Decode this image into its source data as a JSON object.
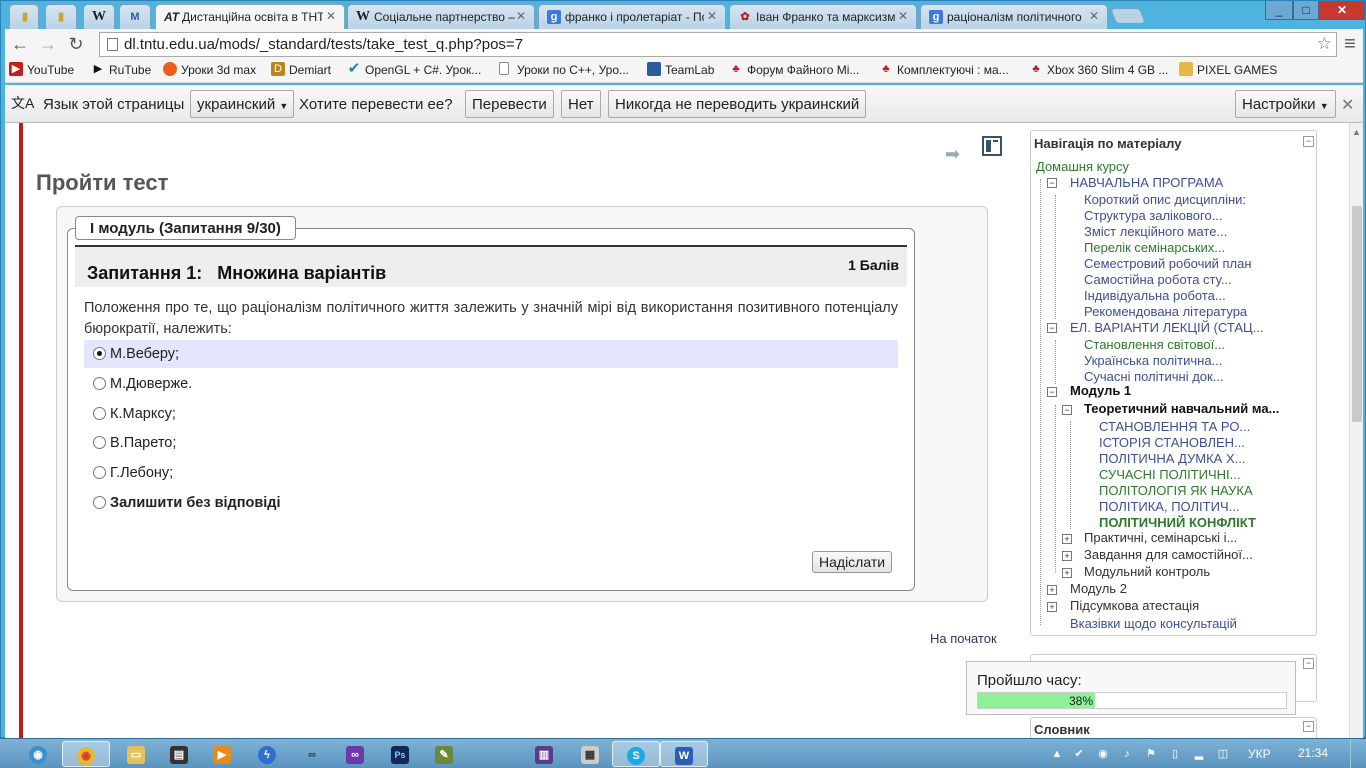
{
  "browser": {
    "tabs": [
      {
        "label": "",
        "icon": "note-icon",
        "pinned": true
      },
      {
        "label": "",
        "icon": "note-icon",
        "pinned": true
      },
      {
        "label": "W",
        "icon": "wikipedia-icon",
        "pinned": true
      },
      {
        "label": "",
        "icon": "moodle-icon",
        "pinned": true
      },
      {
        "label": "Дистанційна освіта в ТНТ",
        "icon": "at-icon",
        "active": true
      },
      {
        "label": "Соціальне партнерство –",
        "icon": "wikipedia-icon"
      },
      {
        "label": "франко і пролетаріат - По",
        "icon": "google-icon"
      },
      {
        "label": "Іван Франко та марксизм",
        "icon": "flower-icon"
      },
      {
        "label": "раціоналізм політичного",
        "icon": "google-icon"
      }
    ],
    "url": "dl.tntu.edu.ua/mods/_standard/tests/take_test_q.php?pos=7",
    "window_buttons": {
      "min": "_",
      "max": "□",
      "close": "✕"
    }
  },
  "bookmarks": [
    {
      "label": "YouTube",
      "icon": "youtube-icon",
      "color": "#cc1b1b"
    },
    {
      "label": "RuTube",
      "icon": "rutube-icon",
      "color": "#111111"
    },
    {
      "label": "Уроки 3d max",
      "icon": "3dmax-icon",
      "color": "#e8601a"
    },
    {
      "label": "Demiart",
      "icon": "demiart-icon",
      "color": "#b8861b"
    },
    {
      "label": "OpenGL + C#. Урок...",
      "icon": "check-icon",
      "color": "#1e7fd0"
    },
    {
      "label": "Уроки по C++, Уро...",
      "icon": "page-icon",
      "color": "#888888"
    },
    {
      "label": "TeamLab",
      "icon": "teamlab-icon",
      "color": "#2a5d9a"
    },
    {
      "label": "Форум Файного Мі...",
      "icon": "forum-icon",
      "color": "#b41d1d"
    },
    {
      "label": "Комплектуючі : ма...",
      "icon": "forum-icon",
      "color": "#b41d1d"
    },
    {
      "label": "Xbox 360 Slim 4 GB ...",
      "icon": "forum-icon",
      "color": "#b41d1d"
    },
    {
      "label": "PIXEL GAMES",
      "icon": "folder-icon",
      "color": "#e6b84a"
    }
  ],
  "translate_bar": {
    "lang_label": "Язык этой страницы",
    "lang_value": "украинский",
    "question": "Хотите перевести ее?",
    "translate_btn": "Перевести",
    "no_btn": "Нет",
    "never_btn": "Никогда не переводить украинский",
    "settings_btn": "Настройки"
  },
  "page": {
    "title": "Пройти тест",
    "legend": "I модуль (Запитання 9/30)",
    "question_title": "Запитання 1:   Множина варіантів",
    "points": "1 Балів",
    "question_text": "Положення про те, що раціоналізм політичного життя залежить у значній мірі від використання позитивного потенціалу бюрократії, належить:",
    "answers": [
      {
        "label": "М.Веберу;",
        "selected": true
      },
      {
        "label": "М.Дюверже.",
        "selected": false
      },
      {
        "label": "К.Марксу;",
        "selected": false
      },
      {
        "label": "В.Парето;",
        "selected": false
      },
      {
        "label": "Г.Лебону;",
        "selected": false
      },
      {
        "label": "Залишити без відповіді",
        "selected": false
      }
    ],
    "submit": "Надіслати",
    "top_link": "На початок"
  },
  "nav": {
    "title": "Навігація по матеріалу",
    "items": [
      {
        "label": "Домашня курсу",
        "style": "green"
      },
      {
        "label": "НАВЧАЛЬНА ПРОГРАМА",
        "style": "link"
      },
      {
        "label": "Короткий опис дисципліни:",
        "style": "link"
      },
      {
        "label": "Структура залікового...",
        "style": "link"
      },
      {
        "label": "Зміст лекційного мате...",
        "style": "link"
      },
      {
        "label": "Перелік семінарських...",
        "style": "green"
      },
      {
        "label": "Семестровий робочий план",
        "style": "link"
      },
      {
        "label": "Самостійна робота сту...",
        "style": "link"
      },
      {
        "label": "Індивідуальна робота...",
        "style": "link"
      },
      {
        "label": "Рекомендована література",
        "style": "link"
      },
      {
        "label": "ЕЛ. ВАРІАНТИ ЛЕКЦІЙ (СТАЦ...",
        "style": "link"
      },
      {
        "label": "Становлення світової...",
        "style": "green"
      },
      {
        "label": "Українська політична...",
        "style": "link"
      },
      {
        "label": "Сучасні політичні док...",
        "style": "link"
      },
      {
        "label": "Модуль 1",
        "style": "bold"
      },
      {
        "label": "Теоретичний навчальний ма...",
        "style": "bold"
      },
      {
        "label": "СТАНОВЛЕННЯ ТА РО...",
        "style": "link"
      },
      {
        "label": "ІСТОРІЯ СТАНОВЛЕН...",
        "style": "link"
      },
      {
        "label": "ПОЛІТИЧНА ДУМКА Х...",
        "style": "link"
      },
      {
        "label": "СУЧАСНІ ПОЛІТИЧНІ...",
        "style": "green"
      },
      {
        "label": "ПОЛІТОЛОГІЯ ЯК НАУКА",
        "style": "green"
      },
      {
        "label": "ПОЛІТИКА, ПОЛІТИЧ...",
        "style": "link"
      },
      {
        "label": "ПОЛІТИЧНИЙ КОНФЛІКТ",
        "style": "greenbold"
      },
      {
        "label": "Практичні, семінарські і...",
        "style": "plain"
      },
      {
        "label": "Завдання для самостійної...",
        "style": "plain"
      },
      {
        "label": "Модульний контроль",
        "style": "plain"
      },
      {
        "label": "Модуль 2",
        "style": "plain"
      },
      {
        "label": "Підсумкова атестація",
        "style": "plain"
      },
      {
        "label": "Вказівки щодо консультацій",
        "style": "link"
      }
    ]
  },
  "timer": {
    "label": "Пройшло часу:",
    "percent_text": "38%",
    "percent": 38
  },
  "glossary_title": "Словник",
  "taskbar": {
    "apps": [
      {
        "name": "chrome",
        "icon": "chrome-icon"
      },
      {
        "name": "explorer",
        "icon": "folder-icon"
      },
      {
        "name": "video",
        "icon": "clapper-icon"
      },
      {
        "name": "media",
        "icon": "play-icon"
      },
      {
        "name": "process",
        "icon": "bolt-icon"
      },
      {
        "name": "glasses",
        "icon": "glasses-icon"
      },
      {
        "name": "visual-studio",
        "icon": "vs-icon"
      },
      {
        "name": "photoshop",
        "icon": "ps-icon"
      },
      {
        "name": "notepad",
        "icon": "notepad-icon"
      },
      {
        "name": "book",
        "icon": "book-icon"
      },
      {
        "name": "calc",
        "icon": "calc-icon"
      },
      {
        "name": "skype",
        "icon": "skype-icon"
      },
      {
        "name": "word",
        "icon": "word-icon"
      }
    ],
    "lang": "УКР",
    "time": "21:34"
  }
}
